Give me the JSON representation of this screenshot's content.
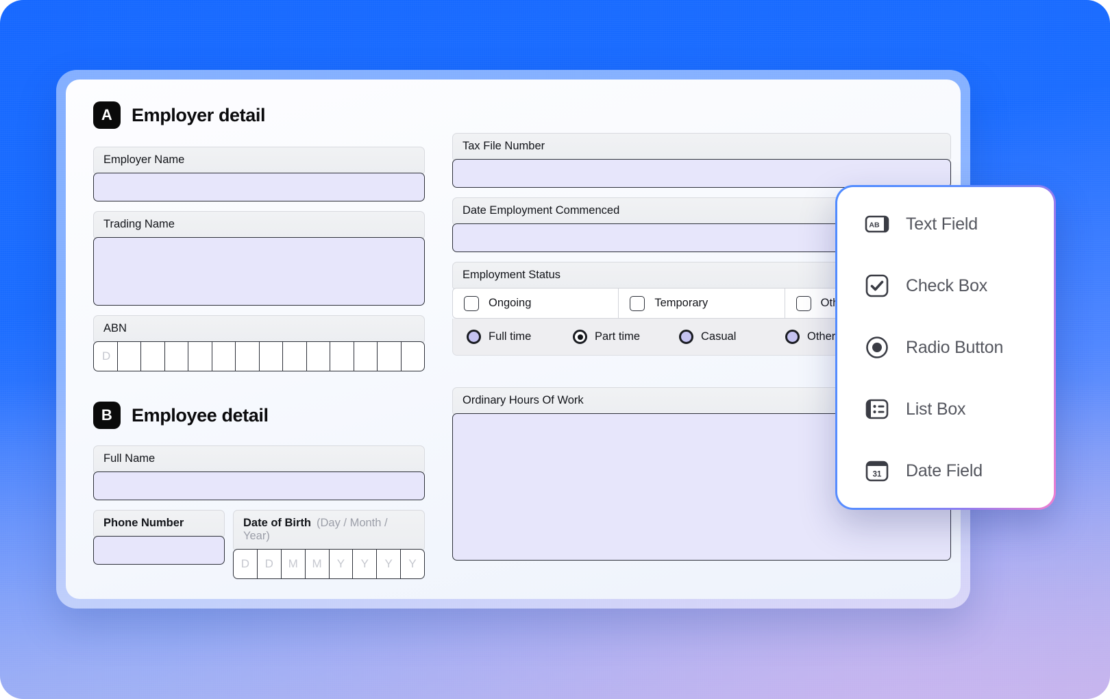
{
  "theme": {
    "bg_blue": "#1668ff",
    "bg_lavender": "#c3b2ec",
    "input_fill": "#e7e6fb",
    "label_fill": "#eceef1",
    "ink": "#0b0b0d",
    "radio_fill": "#c5c3f2",
    "palette_border_from": "#4f8bff",
    "palette_border_to": "#ef7fd0"
  },
  "sections": {
    "employer": {
      "badge": "A",
      "title": "Employer detail"
    },
    "employee": {
      "badge": "B",
      "title": "Employee detail"
    }
  },
  "fields": {
    "employer_name": {
      "label": "Employer Name",
      "value": ""
    },
    "trading_name": {
      "label": "Trading Name",
      "value": ""
    },
    "abn": {
      "label": "ABN",
      "cells": [
        "D",
        "",
        "",
        "",
        "",
        "",
        "",
        "",
        "",
        "",
        "",
        "",
        "",
        ""
      ]
    },
    "full_name": {
      "label": "Full Name",
      "value": ""
    },
    "phone_number": {
      "label": "Phone Number",
      "value": ""
    },
    "date_of_birth": {
      "label": "Date of Birth",
      "hint": "(Day / Month / Year)",
      "cells": [
        "D",
        "D",
        "M",
        "M",
        "Y",
        "Y",
        "Y",
        "Y"
      ]
    },
    "tax_file_number": {
      "label": "Tax File Number",
      "value": ""
    },
    "date_commenced": {
      "label": "Date Employment Commenced",
      "value": ""
    },
    "employment_status": {
      "label": "Employment Status",
      "checkboxes": [
        {
          "label": "Ongoing",
          "checked": false
        },
        {
          "label": "Temporary",
          "checked": false
        },
        {
          "label": "Other(specify)",
          "checked": false
        }
      ],
      "radios": [
        {
          "label": "Full time",
          "selected": false
        },
        {
          "label": "Part time",
          "selected": true
        },
        {
          "label": "Casual",
          "selected": false
        },
        {
          "label": "Other",
          "selected": false
        }
      ]
    },
    "ordinary_hours": {
      "label": "Ordinary Hours Of Work",
      "value": ""
    }
  },
  "palette": {
    "items": [
      {
        "icon": "text-field-icon",
        "label": "Text Field"
      },
      {
        "icon": "check-box-icon",
        "label": "Check Box"
      },
      {
        "icon": "radio-button-icon",
        "label": "Radio Button"
      },
      {
        "icon": "list-box-icon",
        "label": "List Box"
      },
      {
        "icon": "date-field-icon",
        "label": "Date Field"
      }
    ]
  }
}
